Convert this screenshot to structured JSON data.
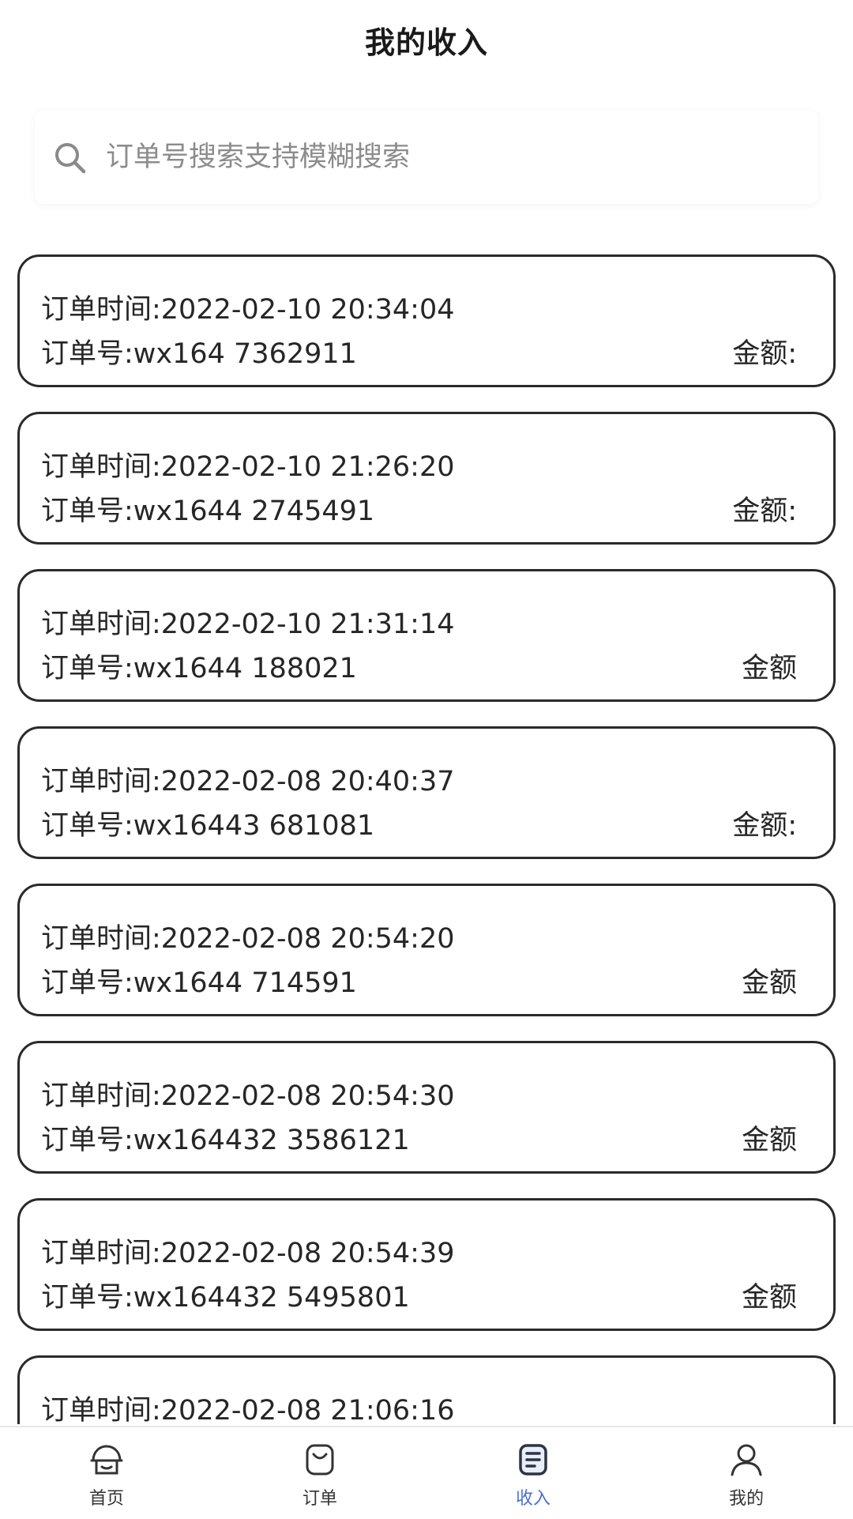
{
  "header": {
    "title": "我的收入"
  },
  "search": {
    "placeholder": "订单号搜索支持模糊搜索",
    "icon": "search-icon"
  },
  "orders": [
    {
      "time_text": "订单时间:2022-02-10 20:34:04",
      "order_text": "订单号:wx164        7362911",
      "amount_label": "金额:"
    },
    {
      "time_text": "订单时间:2022-02-10 21:26:20",
      "order_text": "订单号:wx1644        2745491",
      "amount_label": "金额:"
    },
    {
      "time_text": "订单时间:2022-02-10 21:31:14",
      "order_text": "订单号:wx1644        188021",
      "amount_label": "金额"
    },
    {
      "time_text": "订单时间:2022-02-08 20:40:37",
      "order_text": "订单号:wx16443        681081",
      "amount_label": "金额:"
    },
    {
      "time_text": "订单时间:2022-02-08 20:54:20",
      "order_text": "订单号:wx1644        714591",
      "amount_label": "金额"
    },
    {
      "time_text": "订单时间:2022-02-08 20:54:30",
      "order_text": "订单号:wx164432        3586121",
      "amount_label": "金额"
    },
    {
      "time_text": "订单时间:2022-02-08 20:54:39",
      "order_text": "订单号:wx164432        5495801",
      "amount_label": "金额"
    },
    {
      "time_text": "订单时间:2022-02-08 21:06:16",
      "order_text": "",
      "amount_label": ""
    }
  ],
  "tabbar": {
    "items": [
      {
        "label": "首页",
        "icon": "home-icon"
      },
      {
        "label": "订单",
        "icon": "order-bag-icon"
      },
      {
        "label": "收入",
        "icon": "income-document-icon",
        "active": true
      },
      {
        "label": "我的",
        "icon": "user-icon"
      }
    ],
    "active_color": "#4a6fdc"
  }
}
